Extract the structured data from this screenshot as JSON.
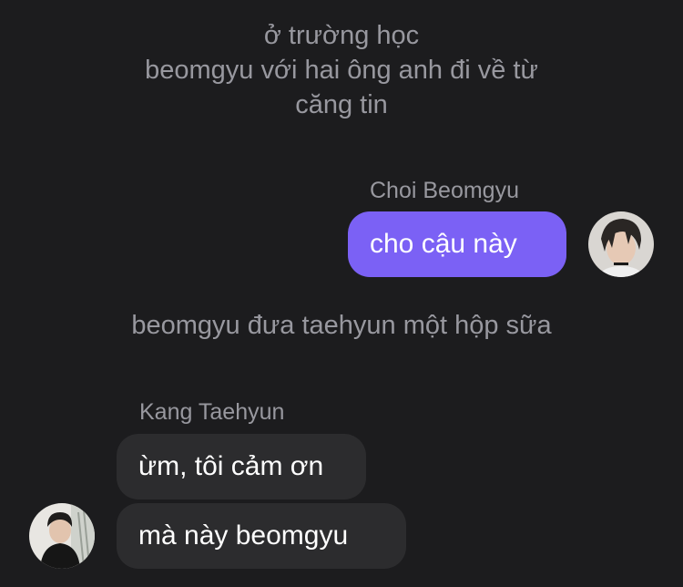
{
  "narration_top": {
    "line1": "ở trường học",
    "line2": "beomgyu với hai ông anh đi về từ",
    "line3": "căng tin"
  },
  "messages": [
    {
      "sender": "Choi Beomgyu",
      "direction": "outgoing",
      "text": "cho cậu này",
      "bubble_color": "#7b61f5"
    }
  ],
  "narration_middle": "beomgyu đưa taehyun một hộp sữa",
  "incoming_group": {
    "sender": "Kang Taehyun",
    "bubble_color": "#2c2c2e",
    "messages": [
      "ừm, tôi cảm ơn",
      "mà này beomgyu"
    ]
  },
  "colors": {
    "background": "#1c1c1e",
    "narration_text": "#98989f",
    "outgoing_bubble": "#7b61f5",
    "incoming_bubble": "#2c2c2e"
  }
}
